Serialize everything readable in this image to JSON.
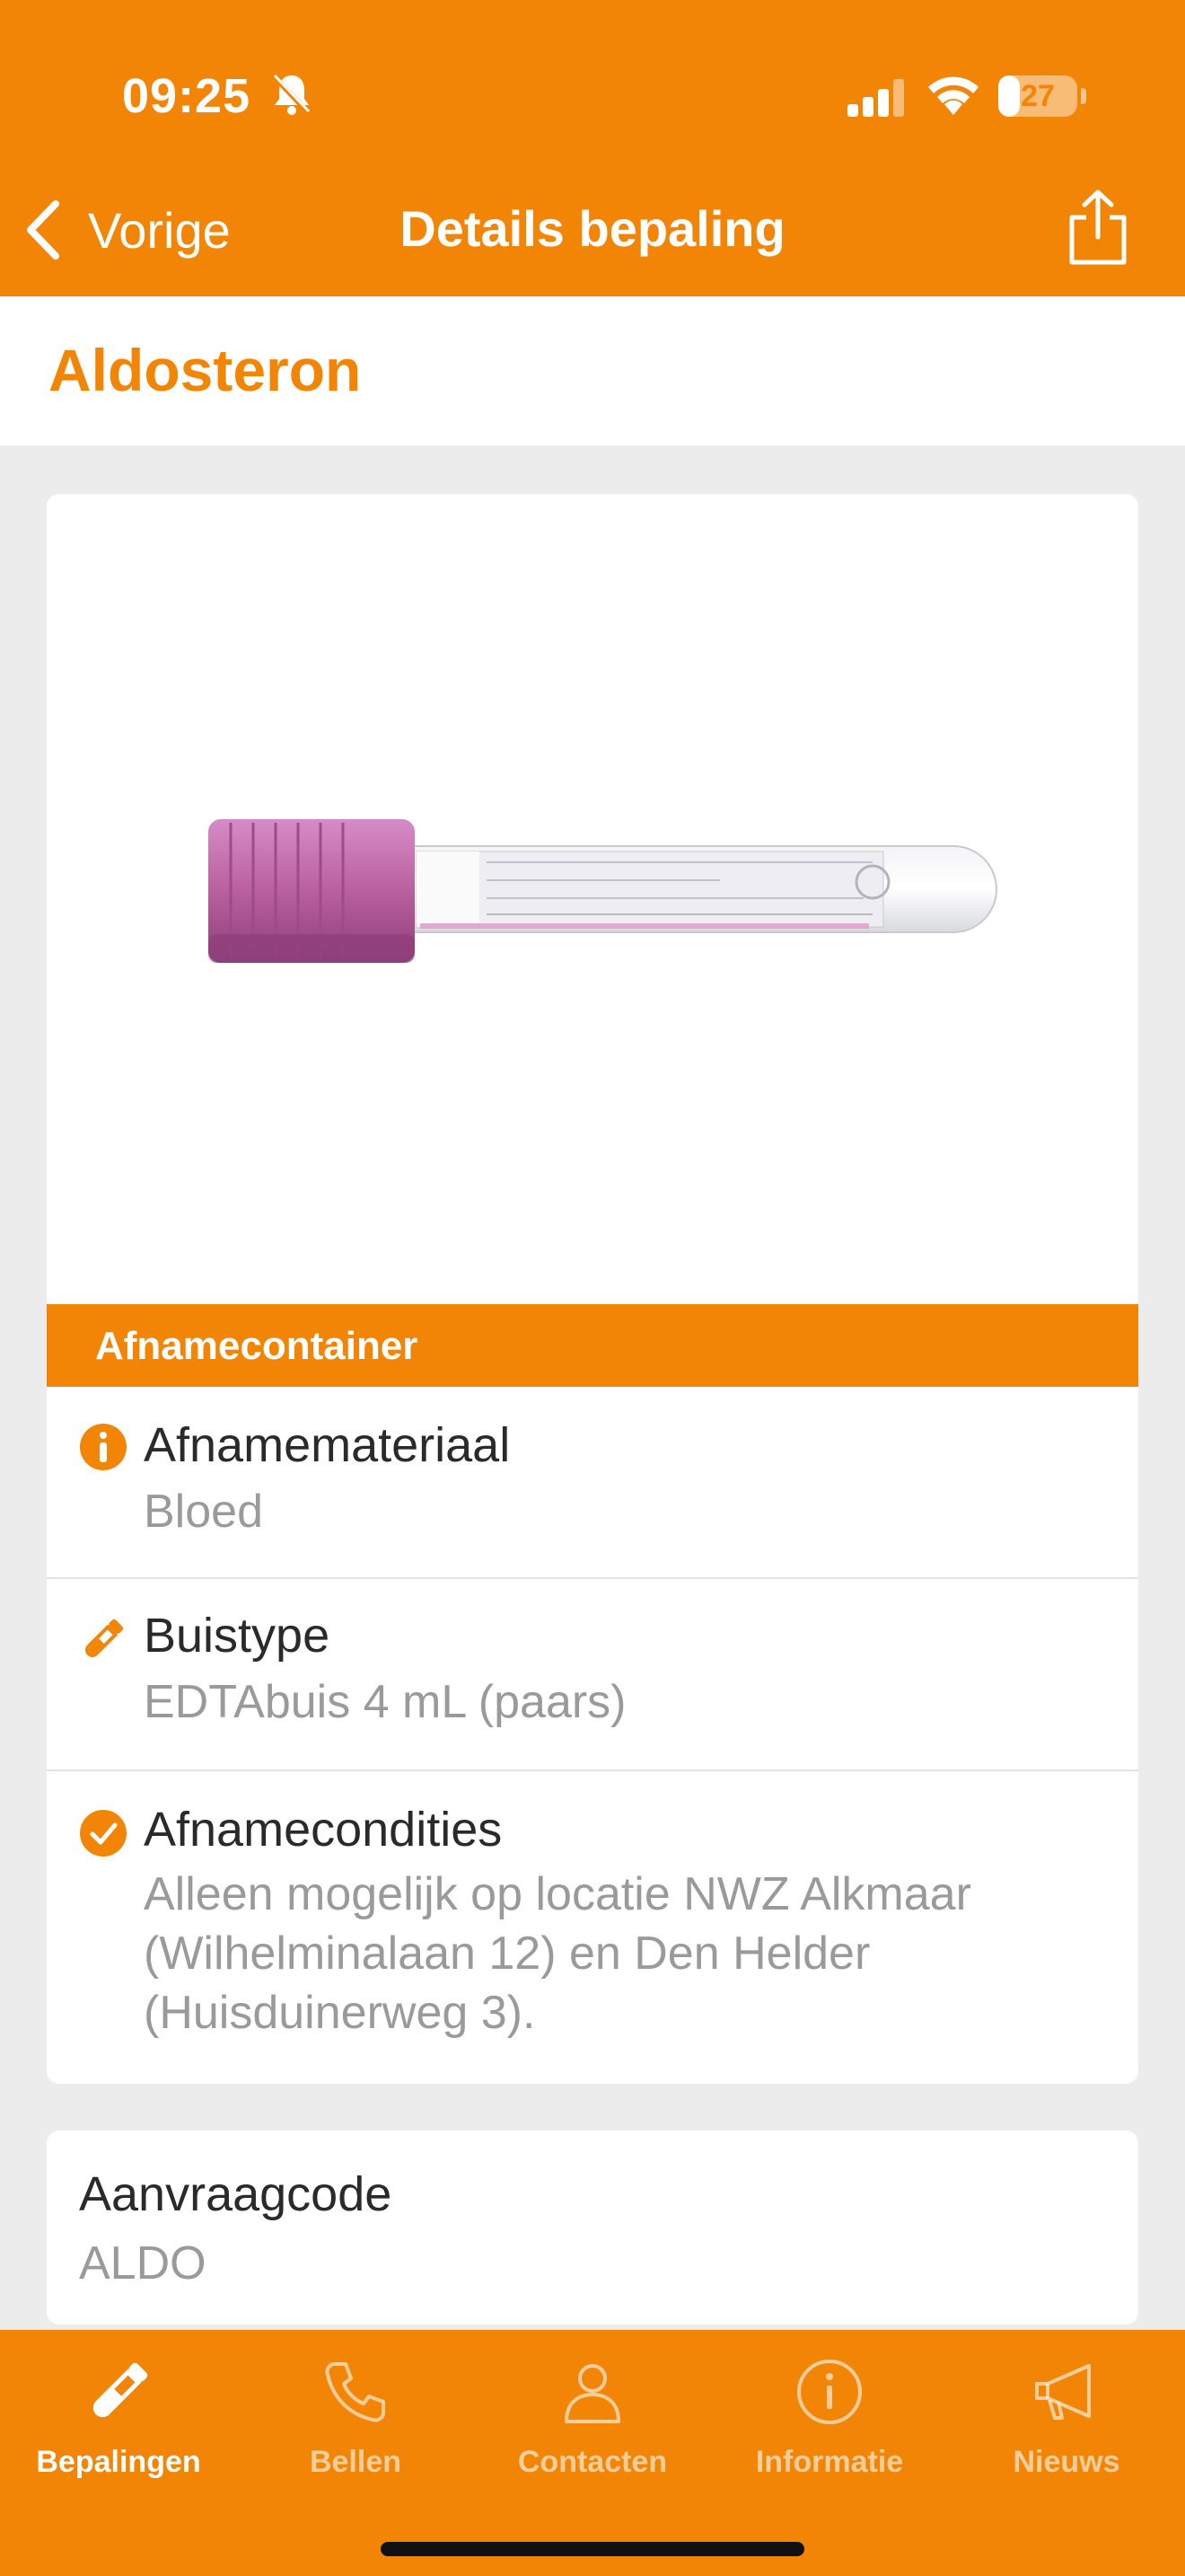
{
  "status_bar": {
    "time": "09:25",
    "battery_level": "27",
    "icons": [
      "bell-slash-icon",
      "signal-icon",
      "wifi-icon",
      "battery-icon"
    ]
  },
  "nav": {
    "back_label": "Vorige",
    "title": "Details bepaling",
    "share_icon": "share-icon"
  },
  "page": {
    "title": "Aldosteron"
  },
  "specimen": {
    "image_alt": "blood-collection-tube-purple-cap",
    "section_label": "Afnamecontainer",
    "rows": [
      {
        "icon": "info-icon",
        "title": "Afnamemateriaal",
        "value": "Bloed"
      },
      {
        "icon": "tube-icon",
        "title": "Buistype",
        "value": "EDTAbuis 4 mL (paars)"
      },
      {
        "icon": "check-circle-icon",
        "title": "Afnamecondities",
        "value": "Alleen mogelijk op locatie NWZ Alkmaar (Wilhelminalaan 12) en Den Helder (Huisduinerweg 3)."
      }
    ]
  },
  "request": {
    "label": "Aanvraagcode",
    "value": "ALDO"
  },
  "tabbar": {
    "items": [
      {
        "label": "Bepalingen",
        "icon": "test-tube-icon",
        "active": true
      },
      {
        "label": "Bellen",
        "icon": "phone-icon",
        "active": false
      },
      {
        "label": "Contacten",
        "icon": "person-icon",
        "active": false
      },
      {
        "label": "Informatie",
        "icon": "info-circle-icon",
        "active": false
      },
      {
        "label": "Nieuws",
        "icon": "megaphone-icon",
        "active": false
      }
    ]
  },
  "colors": {
    "accent": "#f38506",
    "background": "#ececec",
    "card": "#ffffff",
    "muted_text": "#9a9a9a",
    "tube_cap": "#b9609f"
  }
}
